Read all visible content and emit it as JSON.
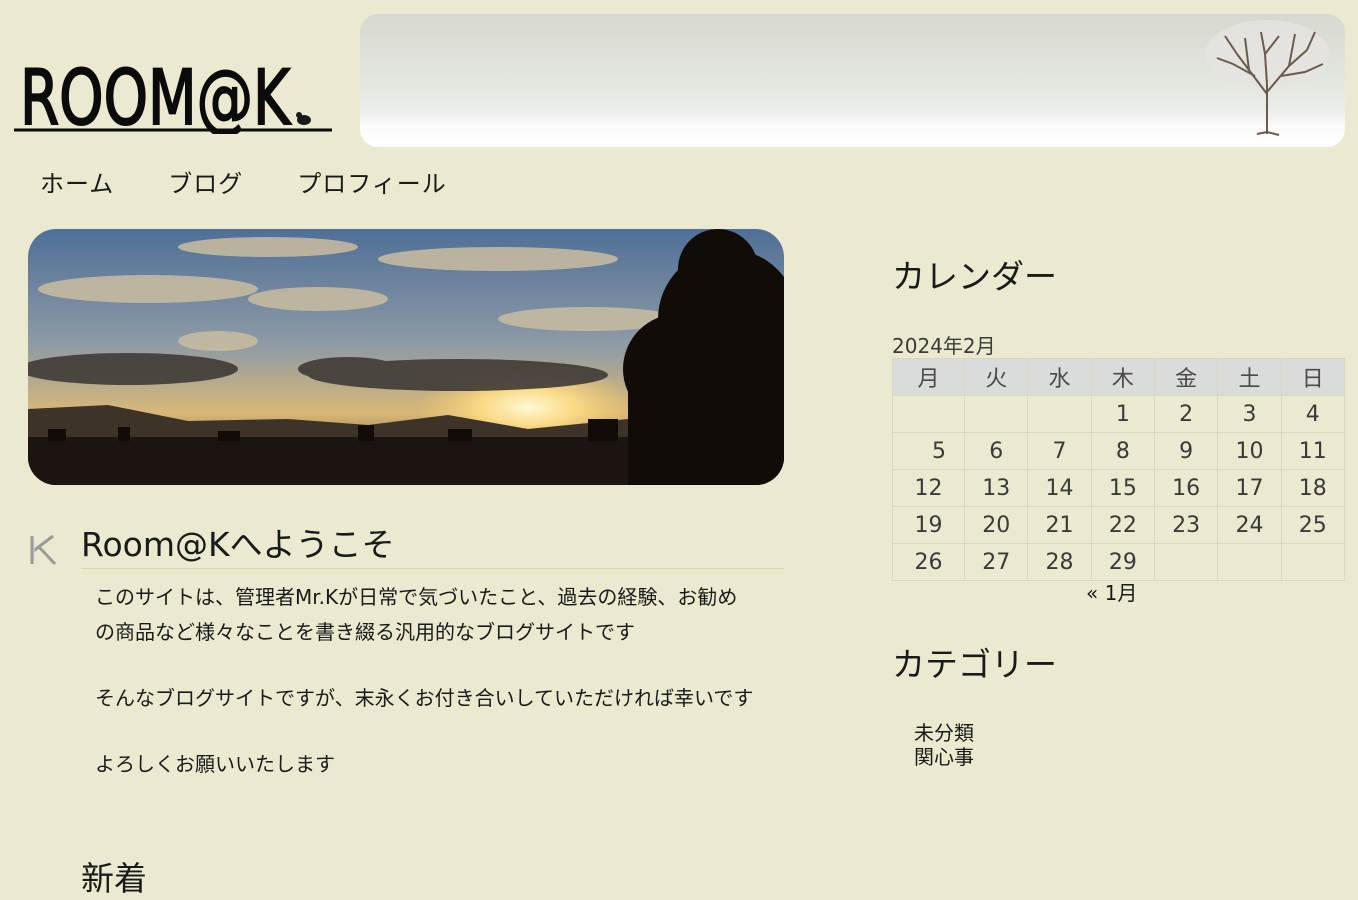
{
  "site": {
    "logo_text": "ROOM@K"
  },
  "nav": [
    {
      "label": "ホーム"
    },
    {
      "label": "ブログ"
    },
    {
      "label": "プロフィール"
    }
  ],
  "post": {
    "title": "Room@Kへようこそ",
    "paragraphs": [
      "このサイトは、管理者Mr.Kが日常で気づいたこと、過去の経験、お勧めの商品など様々なことを書き綴る汎用的なブログサイトです",
      "そんなブログサイトですが、末永くお付き合いしていただければ幸いです",
      "よろしくお願いいたします"
    ]
  },
  "post2": {
    "title": "新着"
  },
  "calendar": {
    "title": "カレンダー",
    "caption": "2024年2月",
    "weekdays": [
      "月",
      "火",
      "水",
      "木",
      "金",
      "土",
      "日"
    ],
    "weeks": [
      [
        "",
        "",
        "",
        "1",
        "2",
        "3",
        "4"
      ],
      [
        "5",
        "6",
        "7",
        "8",
        "9",
        "10",
        "11"
      ],
      [
        "12",
        "13",
        "14",
        "15",
        "16",
        "17",
        "18"
      ],
      [
        "19",
        "20",
        "21",
        "22",
        "23",
        "24",
        "25"
      ],
      [
        "26",
        "27",
        "28",
        "29",
        "",
        "",
        ""
      ]
    ],
    "prev": "« 1月"
  },
  "categories": {
    "title": "カテゴリー",
    "items": [
      "未分類",
      "関心事"
    ]
  }
}
